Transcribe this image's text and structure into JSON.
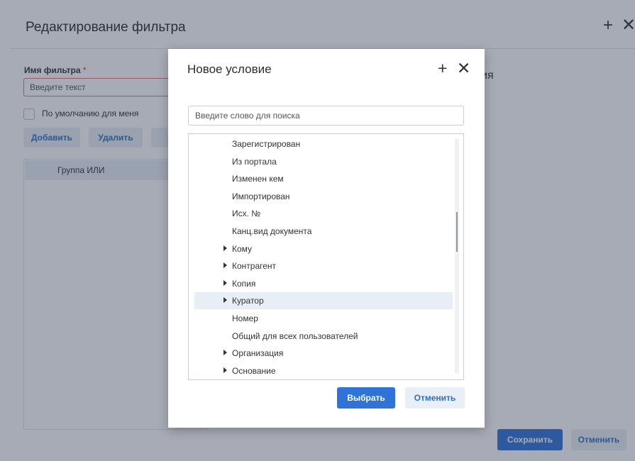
{
  "background_dialog": {
    "title": "Редактирование фильтра",
    "header_icons": [
      "plus-icon",
      "close-icon"
    ],
    "filter_name_label": "Имя фильтра",
    "required_marker": "*",
    "filter_name_placeholder": "Введите текст",
    "default_checkbox_label": "По умолчанию для меня",
    "default_checkbox_checked": false,
    "buttons": {
      "add": "Добавить",
      "delete": "Удалить",
      "group_partial": "Гр"
    },
    "tree_items": [
      "Группа ИЛИ"
    ],
    "partial_right_text": "ия",
    "save_label": "Сохранить",
    "cancel_label": "Отменить"
  },
  "modal": {
    "title": "Новое условие",
    "header_icons": [
      "plus-icon",
      "close-icon"
    ],
    "search_placeholder": "Введите слово для поиска",
    "items": [
      {
        "label": "Зарегистрирован",
        "expandable": false
      },
      {
        "label": "Из портала",
        "expandable": false
      },
      {
        "label": "Изменен кем",
        "expandable": false
      },
      {
        "label": "Импортирован",
        "expandable": false
      },
      {
        "label": "Исх. №",
        "expandable": false
      },
      {
        "label": "Канц.вид документа",
        "expandable": false
      },
      {
        "label": "Кому",
        "expandable": true
      },
      {
        "label": "Контрагент",
        "expandable": true
      },
      {
        "label": "Копия",
        "expandable": true
      },
      {
        "label": "Куратор",
        "expandable": true,
        "selected": true
      },
      {
        "label": "Номер",
        "expandable": false
      },
      {
        "label": "Общий для всех пользователей",
        "expandable": false
      },
      {
        "label": "Организация",
        "expandable": true
      },
      {
        "label": "Основание",
        "expandable": true
      }
    ],
    "select_label": "Выбрать",
    "cancel_label": "Отменить"
  },
  "colors": {
    "primary": "#2f72d8",
    "secondary_button_bg": "#e9eff7",
    "secondary_button_text": "#2e6fc5",
    "selected_row": "#e8eef6",
    "required": "#e53935",
    "overlay": "rgba(45,56,78,0.42)"
  }
}
